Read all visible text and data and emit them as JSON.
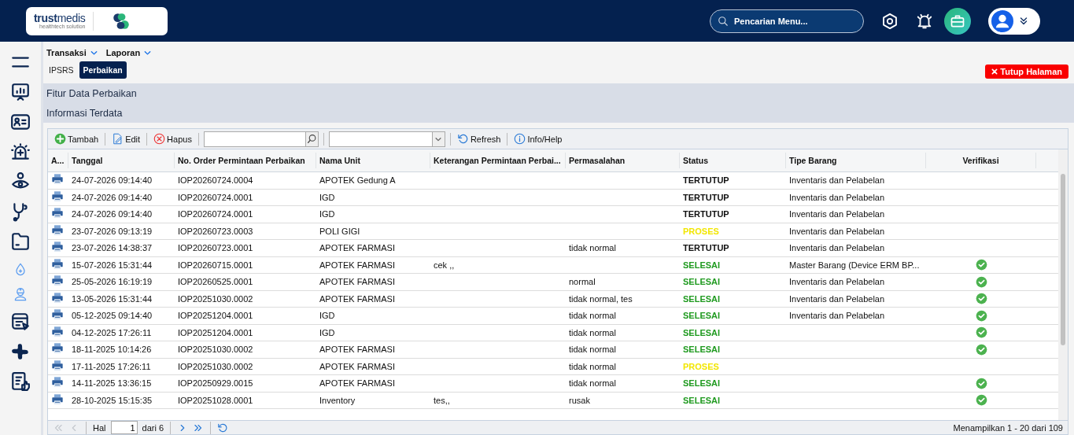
{
  "header": {
    "logo": {
      "name_bold": "trust",
      "name_light": "medis",
      "tagline": "healthtech solution"
    },
    "search": {
      "placeholder": "Pencarian Menu..."
    }
  },
  "sidebar": {
    "items": [
      {
        "highlighted": false
      },
      {
        "highlighted": false
      },
      {
        "highlighted": false
      },
      {
        "highlighted": false
      },
      {
        "highlighted": false
      },
      {
        "highlighted": false
      },
      {
        "highlighted": false
      },
      {
        "highlighted": true
      },
      {
        "highlighted": true
      },
      {
        "highlighted": false
      },
      {
        "highlighted": false
      },
      {
        "highlighted": false
      }
    ]
  },
  "menu": [
    "Transaksi",
    "Laporan"
  ],
  "tabs": [
    {
      "label": "IPSRS",
      "selected": false
    },
    {
      "label": "Perbaikan",
      "selected": true
    }
  ],
  "close_button": "Tutup Halaman",
  "sections": [
    "Fitur Data Perbaikan",
    "Informasi Terdata"
  ],
  "toolbar": {
    "add": "Tambah",
    "edit": "Edit",
    "delete": "Hapus",
    "refresh": "Refresh",
    "help": "Info/Help"
  },
  "table": {
    "columns": [
      "A...",
      "Tanggal",
      "No. Order Permintaan Perbaikan",
      "Nama Unit",
      "Keterangan Permintaan Perbai...",
      "Permasalahan",
      "Status",
      "Tipe Barang",
      "Verifikasi"
    ],
    "rows": [
      {
        "date": "24-07-2026 09:14:40",
        "order": "IOP20260724.0004",
        "unit": "APOTEK Gedung A",
        "note": "",
        "problem": "",
        "status": "TERTUTUP",
        "color": "#111111",
        "type": "Inventaris dan Pelabelan",
        "verified": false
      },
      {
        "date": "24-07-2026 09:14:40",
        "order": "IOP20260724.0001",
        "unit": "IGD",
        "note": "",
        "problem": "",
        "status": "TERTUTUP",
        "color": "#111111",
        "type": "Inventaris dan Pelabelan",
        "verified": false
      },
      {
        "date": "24-07-2026 09:14:40",
        "order": "IOP20260724.0001",
        "unit": "IGD",
        "note": "",
        "problem": "",
        "status": "TERTUTUP",
        "color": "#111111",
        "type": "Inventaris dan Pelabelan",
        "verified": false
      },
      {
        "date": "23-07-2026 09:13:19",
        "order": "IOP20260723.0003",
        "unit": "POLI GIGI",
        "note": "",
        "problem": "",
        "status": "PROSES",
        "color": "#f2e600",
        "type": "Inventaris dan Pelabelan",
        "verified": false
      },
      {
        "date": "23-07-2026 14:38:37",
        "order": "IOP20260723.0001",
        "unit": "APOTEK FARMASI",
        "note": "",
        "problem": "tidak normal",
        "status": "TERTUTUP",
        "color": "#111111",
        "type": "Inventaris dan Pelabelan",
        "verified": false
      },
      {
        "date": "15-07-2026 15:31:44",
        "order": "IOP20260715.0001",
        "unit": "APOTEK FARMASI",
        "note": "cek ,,",
        "problem": "",
        "status": "SELESAI",
        "color": "#1f9a1f",
        "type": "Master Barang (Device ERM BP...",
        "verified": true
      },
      {
        "date": "25-05-2026 16:19:19",
        "order": "IOP20260525.0001",
        "unit": "APOTEK FARMASI",
        "note": "",
        "problem": "normal",
        "status": "SELESAI",
        "color": "#1f9a1f",
        "type": "Inventaris dan Pelabelan",
        "verified": true
      },
      {
        "date": "13-05-2026 15:31:44",
        "order": "IOP20251030.0002",
        "unit": "APOTEK FARMASI",
        "note": "",
        "problem": "tidak normal, tes",
        "status": "SELESAI",
        "color": "#1f9a1f",
        "type": "Inventaris dan Pelabelan",
        "verified": true
      },
      {
        "date": "05-12-2025 09:14:40",
        "order": "IOP20251204.0001",
        "unit": "IGD",
        "note": "",
        "problem": "tidak normal",
        "status": "SELESAI",
        "color": "#1f9a1f",
        "type": "Inventaris dan Pelabelan",
        "verified": true
      },
      {
        "date": "04-12-2025 17:26:11",
        "order": "IOP20251204.0001",
        "unit": "IGD",
        "note": "",
        "problem": "tidak normal",
        "status": "SELESAI",
        "color": "#1f9a1f",
        "type": "",
        "verified": true
      },
      {
        "date": "18-11-2025 10:14:26",
        "order": "IOP20251030.0002",
        "unit": "APOTEK FARMASI",
        "note": "",
        "problem": "tidak normal",
        "status": "SELESAI",
        "color": "#1f9a1f",
        "type": "",
        "verified": true
      },
      {
        "date": "17-11-2025 17:26:11",
        "order": "IOP20251030.0002",
        "unit": "APOTEK FARMASI",
        "note": "",
        "problem": "tidak normal",
        "status": "PROSES",
        "color": "#f2e600",
        "type": "",
        "verified": false
      },
      {
        "date": "14-11-2025 13:36:15",
        "order": "IOP20250929.0015",
        "unit": "APOTEK FARMASI",
        "note": "",
        "problem": "tidak normal",
        "status": "SELESAI",
        "color": "#1f9a1f",
        "type": "",
        "verified": true
      },
      {
        "date": "28-10-2025 15:15:35",
        "order": "IOP20251028.0001",
        "unit": "Inventory",
        "note": "tes,,",
        "problem": "rusak",
        "status": "SELESAI",
        "color": "#1f9a1f",
        "type": "",
        "verified": true
      }
    ]
  },
  "pager": {
    "page_label": "Hal",
    "page": "1",
    "total": "dari 6",
    "summary": "Menampilkan 1 - 20 dari 109"
  }
}
